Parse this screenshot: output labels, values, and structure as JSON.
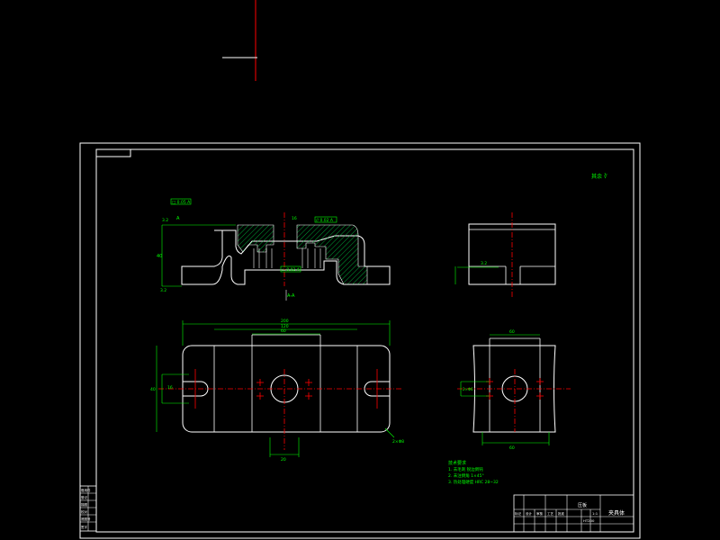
{
  "colors": {
    "background": "#000000",
    "outline": "#ffffff",
    "dimension": "#00ff00",
    "centerline": "#ff0000",
    "hatch": "#00cc44"
  },
  "drawing": {
    "roughness_note": "其余 ∛",
    "front_view": {
      "dims": {
        "flatness": "□ 0.05 A",
        "parallel": "// 0.02 A",
        "perpendicular": "⊥ 0.02 A",
        "height": "40",
        "slot": "16",
        "datum": "A",
        "rough_left": "3.2",
        "rough_bottom": "3.2",
        "section_label": "A-A"
      }
    },
    "side_view": {
      "dims": {
        "rough": "3.2"
      }
    },
    "top_view": {
      "dims": {
        "overall": "200",
        "inner": "120",
        "center": "60",
        "bottom": "20",
        "slot_w": "16",
        "slot_h": "40",
        "hole_note": "2×Φ8"
      }
    },
    "side_plan": {
      "dims": {
        "width": "60",
        "bottom": "60",
        "hole": "2×Φ6"
      }
    }
  },
  "tech_requirements": {
    "heading": "技术要求",
    "items": [
      "1. 去毛刺 锐边倒钝",
      "2. 未注倒角 1×45°",
      "3. 热处理硬度 HRC 28~32"
    ]
  },
  "title_block": {
    "name": "压板",
    "part_name": "夹具体",
    "material": "HT200",
    "scale": "1:1",
    "rows": [
      "标记",
      "设计",
      "审核",
      "工艺",
      "批准"
    ]
  },
  "side_table": {
    "rows": [
      "借用件",
      "登记",
      "描图",
      "校对",
      "底图号",
      "签字"
    ]
  }
}
